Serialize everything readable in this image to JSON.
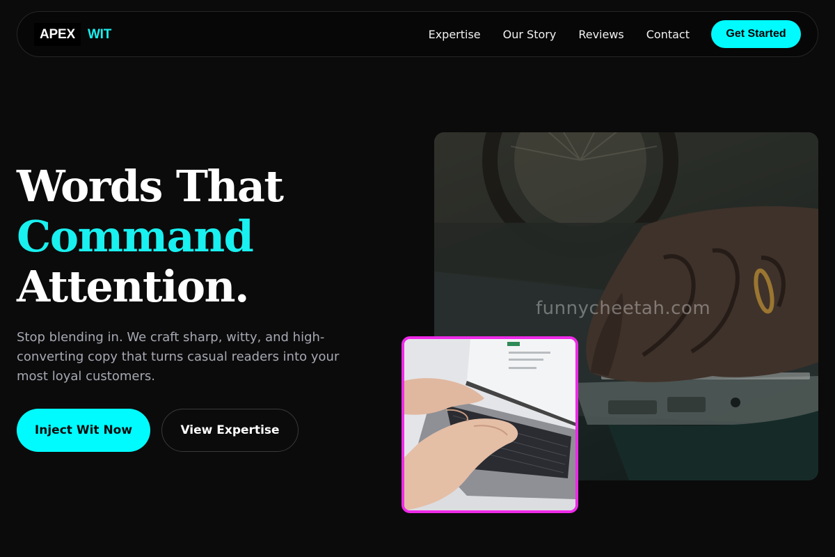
{
  "brand": {
    "logo_text": "APEX",
    "logo_accent": "WIT",
    "accent_color": "#19f0f0",
    "cta_color": "#00fbff",
    "inset_border_color": "#ee2ae8"
  },
  "nav": {
    "links": [
      "Expertise",
      "Our Story",
      "Reviews",
      "Contact"
    ],
    "cta_label": "Get Started"
  },
  "hero": {
    "headline_line1": "Words That",
    "headline_accent": "Command",
    "headline_line3": "Attention.",
    "subcopy": "Stop blending in. We craft sharp, witty, and high-converting copy that turns casual readers into your most loyal customers.",
    "primary_button": "Inject Wit Now",
    "secondary_button": "View Expertise"
  },
  "images": {
    "main_watermark": "funnycheetah.com"
  }
}
